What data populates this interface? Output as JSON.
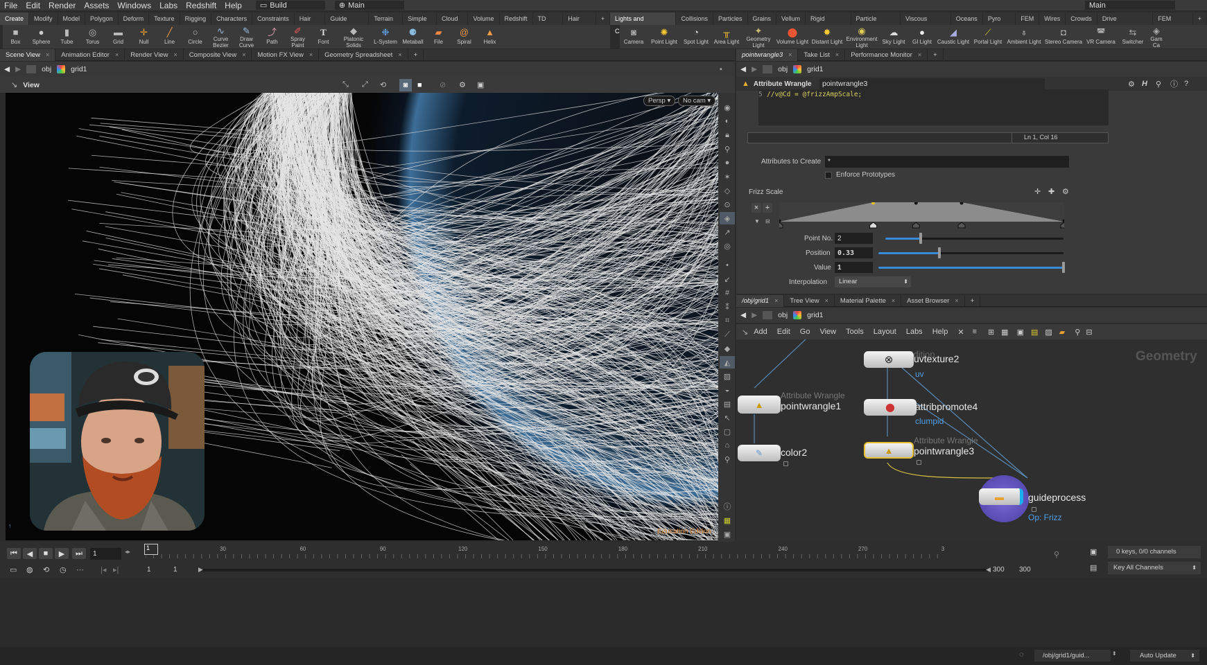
{
  "menubar": {
    "items": [
      "File",
      "Edit",
      "Render",
      "Assets",
      "Windows",
      "Labs",
      "Redshift",
      "Help"
    ],
    "desktop": "Build",
    "context": "Main",
    "right_desktop": "Main"
  },
  "shelf_left": {
    "tabs": [
      "Create",
      "Modify",
      "Model",
      "Polygon",
      "Deform",
      "Texture",
      "Rigging",
      "Characters",
      "Constraints",
      "Hair Utils",
      "Guide Process",
      "Terrain FX",
      "Simple FX",
      "Cloud FX",
      "Volume",
      "Redshift",
      "TD Tools",
      "Hair Tools"
    ],
    "tools": [
      {
        "label": "Box",
        "icon": "box-icon"
      },
      {
        "label": "Sphere",
        "icon": "sphere-icon"
      },
      {
        "label": "Tube",
        "icon": "tube-icon"
      },
      {
        "label": "Torus",
        "icon": "torus-icon"
      },
      {
        "label": "Grid",
        "icon": "grid-icon"
      },
      {
        "label": "Null",
        "icon": "null-icon"
      },
      {
        "label": "Line",
        "icon": "line-icon"
      },
      {
        "label": "Circle",
        "icon": "circle-icon"
      },
      {
        "label": "Curve Bezier",
        "icon": "curve-bezier-icon"
      },
      {
        "label": "Draw Curve",
        "icon": "draw-curve-icon"
      },
      {
        "label": "Path",
        "icon": "path-icon"
      },
      {
        "label": "Spray Paint",
        "icon": "spray-paint-icon"
      },
      {
        "label": "Font",
        "icon": "font-icon"
      },
      {
        "label": "Platonic Solids",
        "icon": "platonic-icon"
      },
      {
        "label": "L-System",
        "icon": "lsystem-icon"
      },
      {
        "label": "Metaball",
        "icon": "metaball-icon"
      },
      {
        "label": "File",
        "icon": "file-icon"
      },
      {
        "label": "Spiral",
        "icon": "spiral-icon"
      },
      {
        "label": "Helix",
        "icon": "helix-icon"
      }
    ]
  },
  "shelf_right": {
    "tabs": [
      "Lights and Cameras",
      "Collisions",
      "Particles",
      "Grains",
      "Vellum",
      "Rigid Bodies",
      "Particle Fluids",
      "Viscous Fluids",
      "Oceans",
      "Pyro FX",
      "FEM",
      "Wires",
      "Crowds",
      "Drive Simulation",
      "FEM Cloth"
    ],
    "tools": [
      {
        "label": "Camera",
        "icon": "camera-icon"
      },
      {
        "label": "Point Light",
        "icon": "point-light-icon"
      },
      {
        "label": "Spot Light",
        "icon": "spot-light-icon"
      },
      {
        "label": "Area Light",
        "icon": "area-light-icon"
      },
      {
        "label": "Geometry Light",
        "icon": "geometry-light-icon"
      },
      {
        "label": "Volume Light",
        "icon": "volume-light-icon"
      },
      {
        "label": "Distant Light",
        "icon": "distant-light-icon"
      },
      {
        "label": "Environment Light",
        "icon": "environment-light-icon"
      },
      {
        "label": "Sky Light",
        "icon": "sky-light-icon"
      },
      {
        "label": "GI Light",
        "icon": "gi-light-icon"
      },
      {
        "label": "Caustic Light",
        "icon": "caustic-light-icon"
      },
      {
        "label": "Portal Light",
        "icon": "portal-light-icon"
      },
      {
        "label": "Ambient Light",
        "icon": "ambient-light-icon"
      },
      {
        "label": "Stereo Camera",
        "icon": "stereo-camera-icon"
      },
      {
        "label": "VR Camera",
        "icon": "vr-camera-icon"
      },
      {
        "label": "Switcher",
        "icon": "switcher-icon"
      },
      {
        "label": "Gam Ca",
        "icon": "gamepad-camera-icon"
      }
    ]
  },
  "left_pane": {
    "tabs": [
      "Scene View",
      "Animation Editor",
      "Render View",
      "Composite View",
      "Motion FX View",
      "Geometry Spreadsheet"
    ],
    "path": [
      "obj",
      "grid1"
    ],
    "view_label": "View",
    "persp": "Persp",
    "cam": "No cam",
    "watermark": "Education Edition"
  },
  "param_pane": {
    "tabs": [
      "pointwrangle3",
      "Take List",
      "Performance Monitor"
    ],
    "path": [
      "obj",
      "grid1"
    ],
    "node_type": "Attribute Wrangle",
    "node_name": "pointwrangle3",
    "code_line_no": "5",
    "code_line": "//v@Cd = @frizzAmpScale;",
    "cursor_pos": "Ln 1, Col 16",
    "attributes_to_create_label": "Attributes to Create",
    "attributes_to_create_value": "*",
    "enforce_prototypes": "Enforce Prototypes",
    "ramp_label": "Frizz Scale",
    "point_no_label": "Point No.",
    "point_no": "2",
    "position_label": "Position",
    "position": "0.33",
    "value_label": "Value",
    "value": "1",
    "interp_label": "Interpolation",
    "interp": "Linear",
    "ramp_keys": [
      0.0,
      0.33,
      0.48,
      0.64,
      1.0
    ],
    "ramp_values": [
      0.0,
      1.0,
      1.0,
      1.0,
      0.0
    ],
    "point_no_frac": 0.2,
    "position_frac": 0.33,
    "value_frac": 1.0
  },
  "network_pane": {
    "tabs": [
      "/obj/grid1",
      "Tree View",
      "Material Palette",
      "Asset Browser"
    ],
    "path": [
      "obj",
      "grid1"
    ],
    "menu": [
      "Add",
      "Edit",
      "Go",
      "View",
      "Tools",
      "Layout",
      "Labs",
      "Help"
    ],
    "context_label": "Geometry",
    "faint_label": "n Edition",
    "nodes": {
      "uvtexture": {
        "name": "uvtexture2",
        "sub": "uv"
      },
      "pw1": {
        "type": "Attribute Wrangle",
        "name": "pointwrangle1"
      },
      "attribpromote": {
        "name": "attribpromote4",
        "sub": "clumpid"
      },
      "color": {
        "name": "color2"
      },
      "pw3": {
        "type": "Attribute Wrangle",
        "name": "pointwrangle3"
      },
      "guide": {
        "name": "guideprocess",
        "sub": "Op: Frizz"
      }
    }
  },
  "timeline": {
    "frame": "1",
    "start": "1",
    "start2": "1",
    "end": "300",
    "end2": "300",
    "ticks": [
      "1",
      "30",
      "60",
      "90",
      "120",
      "150",
      "180",
      "210",
      "240",
      "270",
      "3"
    ],
    "keys_info": "0 keys, 0/0 channels",
    "key_all": "Key All Channels"
  },
  "statusbar": {
    "path": "/obj/grid1/guid...",
    "update": "Auto Update"
  }
}
